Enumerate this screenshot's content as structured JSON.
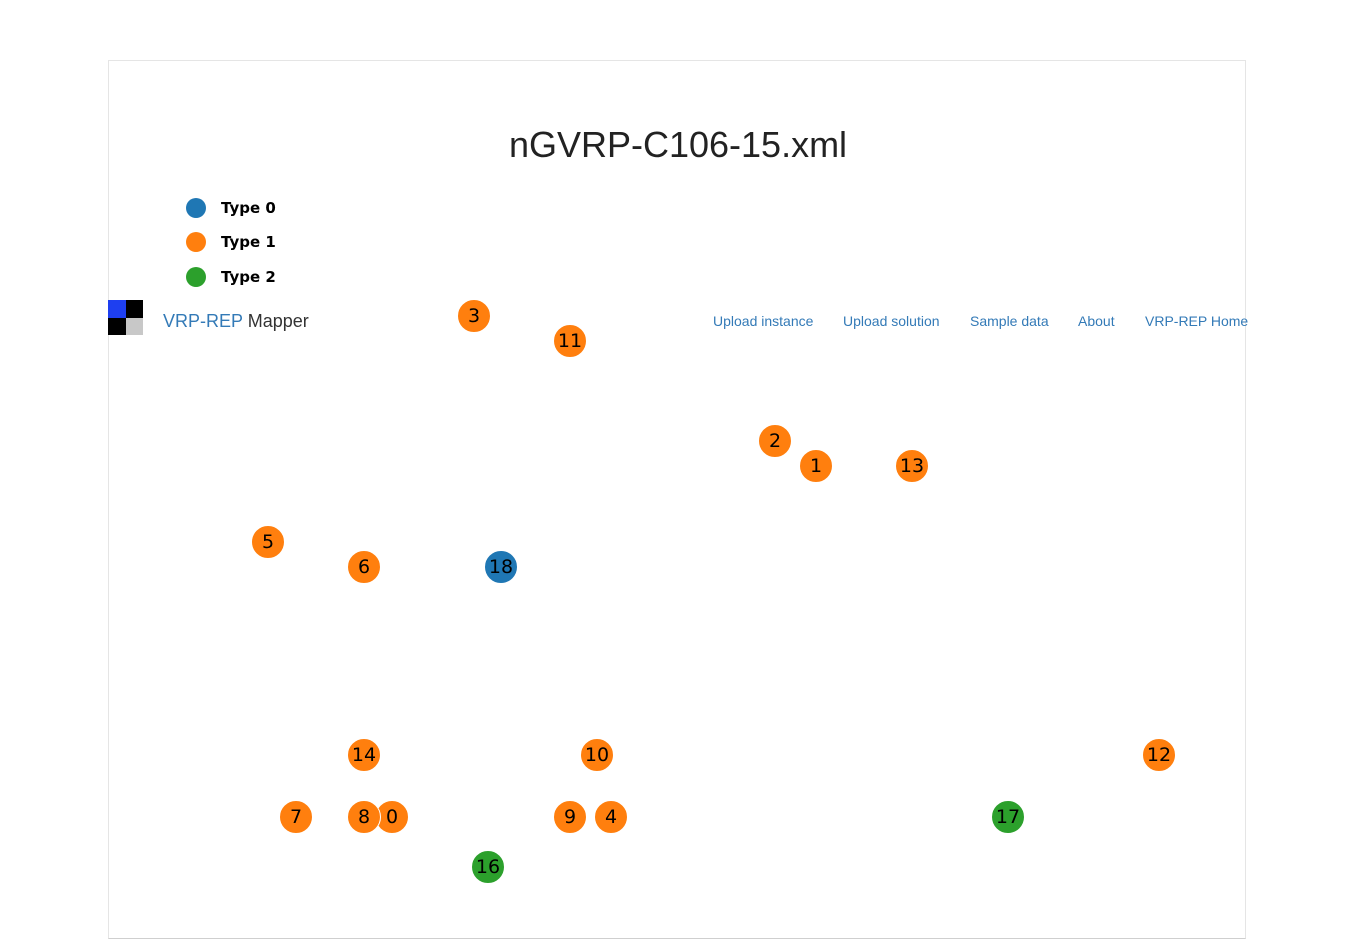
{
  "title": "nGVRP-C106-15.xml",
  "legend": [
    {
      "label": "Type 0",
      "color": "#1f77b4"
    },
    {
      "label": "Type 1",
      "color": "#ff7f0e"
    },
    {
      "label": "Type 2",
      "color": "#2ca02c"
    }
  ],
  "navbar": {
    "brand_prefix": "VRP-REP",
    "brand_suffix": "Mapper",
    "links": [
      "Upload instance",
      "Upload solution",
      "Sample data",
      "About",
      "VRP-REP Home"
    ],
    "logo_colors": [
      "#1e3ff0",
      "#000000",
      "#000000",
      "#c8c8c8"
    ]
  },
  "nodes": [
    {
      "id": "0",
      "type": 1
    },
    {
      "id": "1",
      "type": 1
    },
    {
      "id": "2",
      "type": 1
    },
    {
      "id": "3",
      "type": 1
    },
    {
      "id": "4",
      "type": 1
    },
    {
      "id": "5",
      "type": 1
    },
    {
      "id": "6",
      "type": 1
    },
    {
      "id": "7",
      "type": 1
    },
    {
      "id": "8",
      "type": 1
    },
    {
      "id": "9",
      "type": 1
    },
    {
      "id": "10",
      "type": 1
    },
    {
      "id": "11",
      "type": 1
    },
    {
      "id": "12",
      "type": 1
    },
    {
      "id": "13",
      "type": 1
    },
    {
      "id": "14",
      "type": 1
    },
    {
      "id": "16",
      "type": 2
    },
    {
      "id": "17",
      "type": 2
    },
    {
      "id": "18",
      "type": 0
    }
  ]
}
